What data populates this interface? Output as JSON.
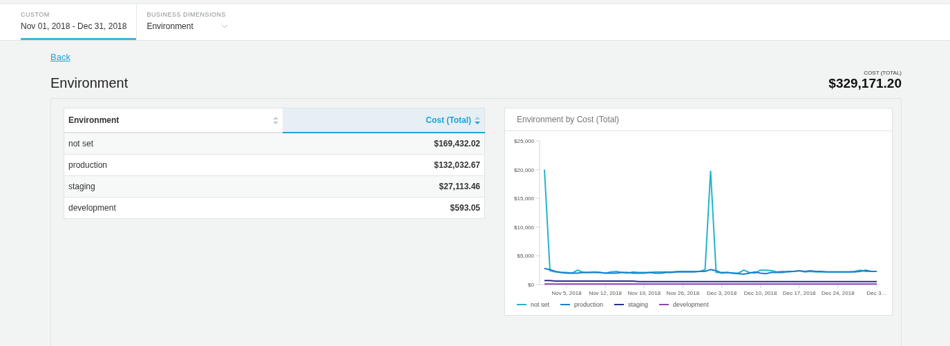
{
  "filters": [
    {
      "label": "CUSTOM",
      "value": "Nov 01, 2018 - Dec 31, 2018",
      "selected": true,
      "kind": "date"
    },
    {
      "label": "BUSINESS DIMENSIONS",
      "value": "Environment",
      "selected": false,
      "kind": "dropdown"
    }
  ],
  "back_link": "Back",
  "title": "Environment",
  "total": {
    "label": "COST (TOTAL)",
    "value": "$329,171.20"
  },
  "table": {
    "columns": [
      {
        "label": "Environment",
        "selected": false
      },
      {
        "label": "Cost (Total)",
        "selected": true
      }
    ],
    "rows": [
      [
        "not set",
        "$169,432.02"
      ],
      [
        "production",
        "$132,032.67"
      ],
      [
        "staging",
        "$27,113.46"
      ],
      [
        "development",
        "$593.05"
      ]
    ]
  },
  "chart": {
    "title": "Environment by Cost (Total)",
    "chart_data": {
      "type": "line",
      "categories": [
        null,
        null,
        null,
        null,
        "Nov 5, 2018",
        null,
        null,
        null,
        null,
        null,
        null,
        "Nov 12, 2018",
        null,
        null,
        null,
        null,
        null,
        null,
        "Nov 19, 2018",
        null,
        null,
        null,
        null,
        null,
        null,
        "Nov 26, 2018",
        null,
        null,
        null,
        null,
        null,
        null,
        "Dec 3, 2018",
        null,
        null,
        null,
        null,
        null,
        null,
        "Dec 10, 2018",
        null,
        null,
        null,
        null,
        null,
        null,
        "Dec 17, 2018",
        null,
        null,
        null,
        null,
        null,
        null,
        "Dec 24, 2018",
        null,
        null,
        null,
        null,
        null,
        null,
        "Dec 3…"
      ],
      "ylim": [
        0,
        25000
      ],
      "yticks": [
        {
          "value": 0,
          "label": "$0"
        },
        {
          "value": 5000,
          "label": "$5,000"
        },
        {
          "value": 10000,
          "label": "$10,000"
        },
        {
          "value": 15000,
          "label": "$15,000"
        },
        {
          "value": 20000,
          "label": "$20,000"
        },
        {
          "value": 25000,
          "label": "$25,000"
        }
      ],
      "series": [
        {
          "name": "not set",
          "color": "#1fb5c9",
          "values": [
            20000,
            2400,
            2200,
            2100,
            2100,
            2000,
            2500,
            2100,
            2100,
            2200,
            2100,
            2000,
            2200,
            2300,
            2100,
            2000,
            2200,
            2100,
            2100,
            2100,
            2200,
            2200,
            2200,
            2200,
            2300,
            2300,
            2300,
            2300,
            2300,
            2600,
            19800,
            2100,
            2100,
            2100,
            2000,
            2000,
            2500,
            2100,
            2000,
            2500,
            2500,
            2400,
            2200,
            2300,
            2200,
            2300,
            2400,
            2200,
            2300,
            2200,
            2200,
            2200,
            2200,
            2200,
            2200,
            2200,
            2300,
            2500,
            2300,
            2300,
            2300
          ]
        },
        {
          "name": "production",
          "color": "#1a7fcf",
          "values": [
            2800,
            2600,
            2300,
            2100,
            2000,
            2000,
            2000,
            2100,
            2100,
            2100,
            2100,
            2000,
            2000,
            2000,
            2100,
            2100,
            2000,
            2000,
            2000,
            2100,
            2000,
            2000,
            2100,
            2100,
            2200,
            2200,
            2200,
            2200,
            2300,
            2300,
            2600,
            2400,
            2000,
            2100,
            2000,
            1900,
            1800,
            2000,
            2200,
            2000,
            1900,
            2100,
            2100,
            2100,
            2300,
            2300,
            2400,
            2300,
            2400,
            2300,
            2300,
            2200,
            2200,
            2200,
            2200,
            2200,
            2200,
            2300,
            2500,
            2300,
            2300
          ]
        },
        {
          "name": "staging",
          "color": "#2e2f8f",
          "values": [
            700,
            700,
            600,
            600,
            600,
            600,
            600,
            600,
            600,
            600,
            600,
            600,
            600,
            600,
            600,
            600,
            600,
            500,
            500,
            500,
            500,
            500,
            500,
            500,
            500,
            500,
            500,
            500,
            500,
            500,
            500,
            500,
            500,
            500,
            500,
            500,
            500,
            500,
            500,
            500,
            500,
            500,
            500,
            500,
            500,
            500,
            500,
            500,
            500,
            500,
            500,
            500,
            500,
            500,
            500,
            500,
            500,
            500,
            500,
            500,
            500
          ]
        },
        {
          "name": "development",
          "color": "#8e44ad",
          "values": [
            100,
            100,
            100,
            100,
            100,
            100,
            100,
            100,
            100,
            100,
            100,
            100,
            100,
            100,
            100,
            100,
            100,
            100,
            100,
            100,
            100,
            100,
            100,
            100,
            100,
            100,
            100,
            100,
            100,
            100,
            100,
            100,
            100,
            100,
            100,
            100,
            100,
            100,
            100,
            100,
            100,
            100,
            100,
            100,
            100,
            100,
            100,
            100,
            100,
            100,
            100,
            100,
            100,
            100,
            100,
            100,
            100,
            100,
            100,
            100,
            100
          ]
        }
      ]
    }
  }
}
